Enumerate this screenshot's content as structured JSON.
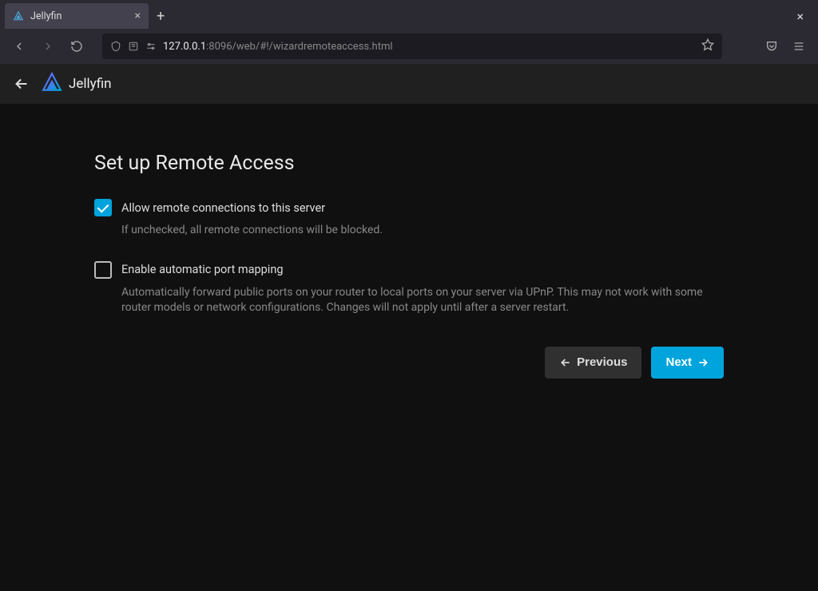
{
  "browser": {
    "tab_title": "Jellyfin",
    "url_host": "127.0.0.1",
    "url_port_path": ":8096/web/#!/wizardremoteaccess.html"
  },
  "app": {
    "brand": "Jellyfin"
  },
  "wizard": {
    "title": "Set up Remote Access",
    "options": {
      "remote": {
        "label": "Allow remote connections to this server",
        "desc": "If unchecked, all remote connections will be blocked.",
        "checked": true
      },
      "upnp": {
        "label": "Enable automatic port mapping",
        "desc": "Automatically forward public ports on your router to local ports on your server via UPnP. This may not work with some router models or network configurations. Changes will not apply until after a server restart.",
        "checked": false
      }
    },
    "buttons": {
      "previous": "Previous",
      "next": "Next"
    }
  }
}
